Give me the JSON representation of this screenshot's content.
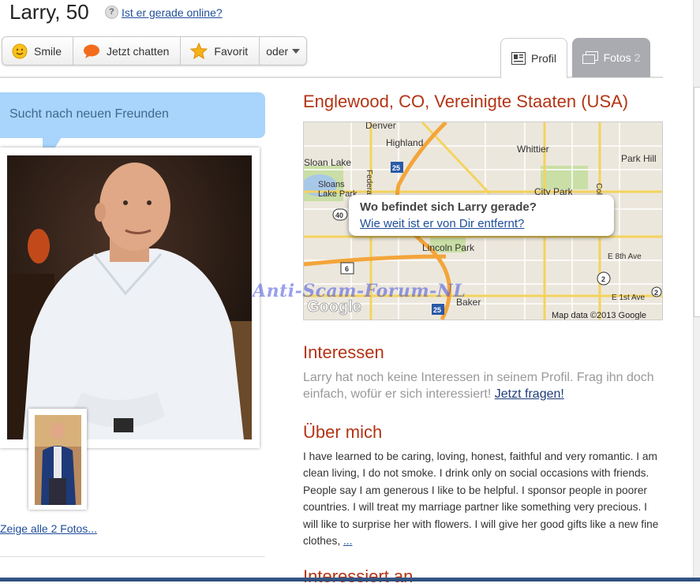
{
  "header": {
    "name_age": "Larry, 50",
    "help_symbol": "?",
    "online_link": "Ist er gerade online?"
  },
  "actions": {
    "smile": "Smile",
    "chat": "Jetzt chatten",
    "favorite": "Favorit",
    "more": "oder"
  },
  "tabs": {
    "profil": "Profil",
    "fotos": "Fotos",
    "fotos_count": "2"
  },
  "left": {
    "bubble": "Sucht nach neuen Freunden",
    "all_photos": "Zeige alle 2 Fotos..."
  },
  "location": {
    "title": "Englewood, CO, Vereinigte Staaten (USA)",
    "map_popup_question": "Wo befindet sich Larry gerade?",
    "map_popup_link": "Wie weit ist er von Dir entfernt?",
    "map_labels": [
      "Denver",
      "Highland",
      "Whittier",
      "Sloan Lake",
      "Park Hill",
      "Sloans Lake Park",
      "City Park",
      "Federal Blvd",
      "Lincoln Park",
      "E 8th Ave",
      "Baker",
      "E 1st Ave",
      "Colo"
    ],
    "map_shields": [
      "25",
      "40",
      "6",
      "2",
      "25",
      "2"
    ],
    "map_logo": "Google",
    "map_credit": "Map data ©2013 Google",
    "watermark": "Anti-Scam-Forum-NL"
  },
  "interests": {
    "title": "Interessen",
    "text": "Larry hat noch keine Interessen in seinem Profil. Frag ihn doch einfach, wofür er sich interessiert!",
    "link": "Jetzt fragen!"
  },
  "about": {
    "title": "Über mich",
    "text": "I have learned to be caring, loving, honest, faithful and very romantic. I am clean living, I do not smoke. I drink only on social occasions with friends. People say I am generous I like to be helpful. I sponsor people in poorer countries. I will treat my marriage partner like something very precious. I will like to surprise her with flowers. I will give her good gifts like a new fine clothes,",
    "more_link": "..."
  },
  "next_section": {
    "title": "Interessiert an"
  },
  "colors": {
    "heading": "#b33414",
    "bubble": "#a9d4fb",
    "link": "#1f4e9a"
  }
}
